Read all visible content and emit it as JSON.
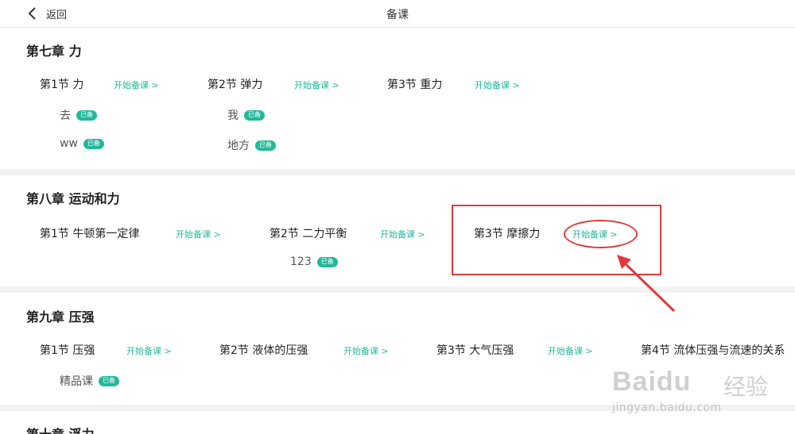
{
  "header": {
    "back_label": "返回",
    "title": "备课"
  },
  "colors": {
    "accent": "#22b99a",
    "highlight": "#e03a3a"
  },
  "chapters": [
    {
      "title": "第七章 力",
      "sections": [
        {
          "name": "第1节 力",
          "action": "开始备课 >",
          "lessons": [
            {
              "name": "去",
              "badge": "已备"
            },
            {
              "name": "ww",
              "badge": "已备"
            }
          ]
        },
        {
          "name": "第2节 弹力",
          "action": "开始备课 >",
          "lessons": [
            {
              "name": "我",
              "badge": "已备"
            },
            {
              "name": "地方",
              "badge": "已备"
            }
          ]
        },
        {
          "name": "第3节 重力",
          "action": "开始备课 >",
          "lessons": []
        }
      ]
    },
    {
      "title": "第八章 运动和力",
      "sections": [
        {
          "name": "第1节 牛顿第一定律",
          "action": "开始备课 >",
          "lessons": []
        },
        {
          "name": "第2节 二力平衡",
          "action": "开始备课 >",
          "lessons": [
            {
              "name": "123",
              "badge": "已备"
            }
          ]
        },
        {
          "name": "第3节 摩擦力",
          "action": "开始备课 >",
          "lessons": []
        }
      ]
    },
    {
      "title": "第九章 压强",
      "sections": [
        {
          "name": "第1节 压强",
          "action": "开始备课 >",
          "lessons": [
            {
              "name": "精品课",
              "badge": "已备"
            }
          ]
        },
        {
          "name": "第2节 液体的压强",
          "action": "开始备课 >",
          "lessons": []
        },
        {
          "name": "第3节 大气压强",
          "action": "开始备课 >",
          "lessons": []
        },
        {
          "name": "第4节 流体压强与流速的关系",
          "action": "",
          "lessons": []
        }
      ]
    },
    {
      "title": "第十章 浮力",
      "sections": []
    }
  ],
  "watermark": {
    "logo": "Baidu",
    "word": "经验",
    "url": "jingyan.baidu.com"
  }
}
